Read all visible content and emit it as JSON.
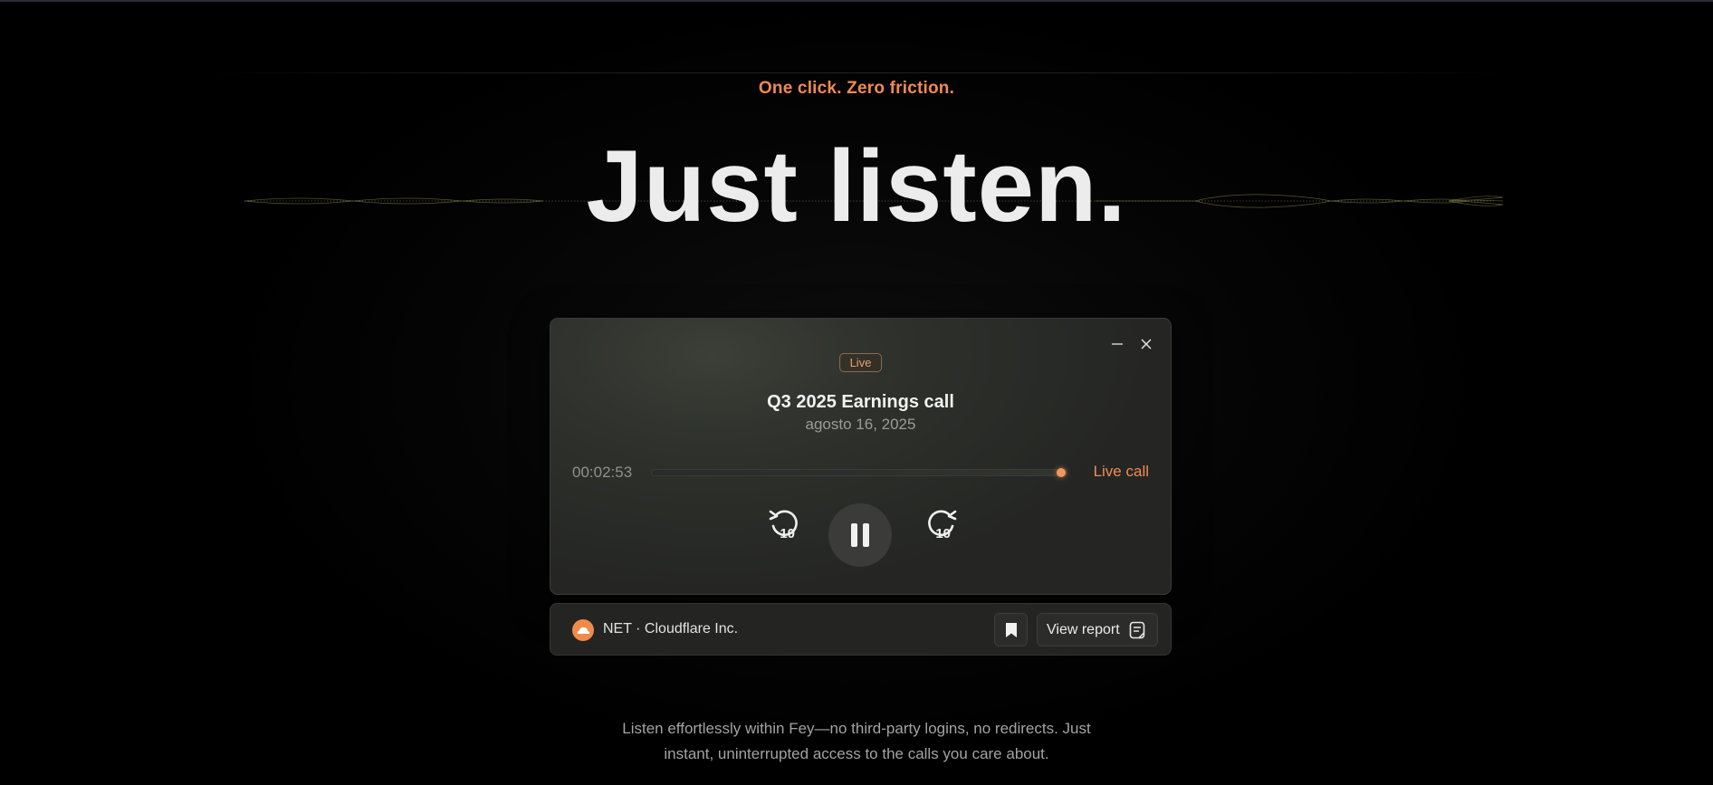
{
  "hero": {
    "tagline": "One click. Zero friction.",
    "headline": "Just listen."
  },
  "player": {
    "badge": "Live",
    "title": "Q3 2025 Earnings call",
    "date": "agosto 16, 2025",
    "elapsed": "00:02:53",
    "live_label": "Live call",
    "progress": 1.0,
    "skip_seconds": "10",
    "window_controls": {
      "minimize_icon": "minus-icon",
      "close_icon": "close-icon"
    },
    "pause_icon": "pause-icon"
  },
  "infobar": {
    "company": "NET · Cloudflare Inc.",
    "company_logo_icon": "cloud-icon",
    "bookmark_icon": "bookmark-icon",
    "report_label": "View report",
    "report_icon": "document-icon"
  },
  "description": {
    "line1": "Listen effortlessly within Fey—no third-party logins, no redirects. Just",
    "line2": "instant, uninterrupted access to the calls you care about."
  },
  "colors": {
    "accent": "#f08a55",
    "background": "#000000",
    "card": "#2d302b"
  }
}
